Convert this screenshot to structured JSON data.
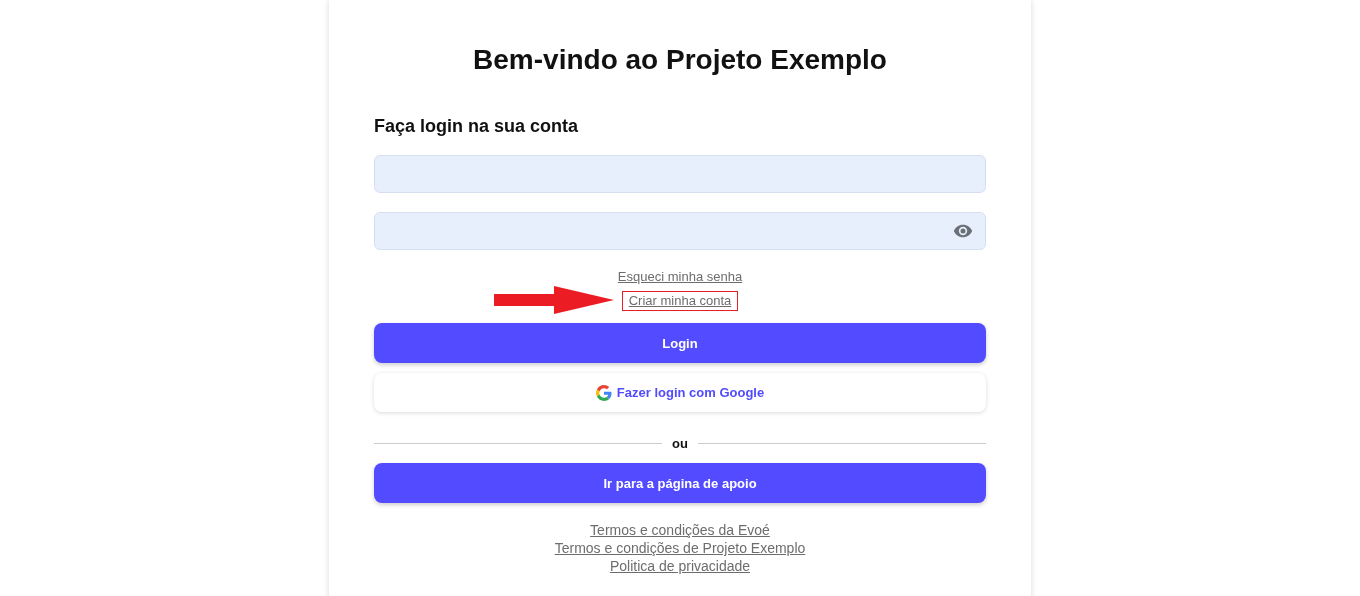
{
  "title": "Bem-vindo ao Projeto Exemplo",
  "subtitle": "Faça login na sua conta",
  "fields": [
    {
      "kind": "text"
    },
    {
      "kind": "password"
    }
  ],
  "links": [
    {
      "label": "Esqueci minha senha",
      "highlighted": false
    },
    {
      "label": "Criar minha conta",
      "highlighted": true
    }
  ],
  "login_button": "Login",
  "google_button": "Fazer login com Google",
  "divider": "ou",
  "support_button": "Ir para a página de apoio",
  "footer_links": [
    "Termos e condições da Evoé",
    "Termos e condições de Projeto Exemplo",
    "Politica de privacidade"
  ]
}
